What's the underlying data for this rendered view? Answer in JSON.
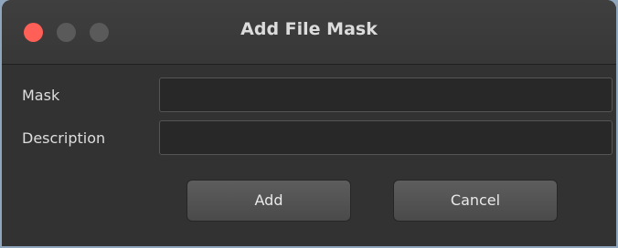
{
  "window": {
    "title": "Add File Mask",
    "traffic_lights": [
      "close-light",
      "minimize-light",
      "zoom-light"
    ]
  },
  "form": {
    "mask": {
      "label": "Mask",
      "value": "",
      "placeholder": ""
    },
    "description": {
      "label": "Description",
      "value": "",
      "placeholder": ""
    }
  },
  "buttons": {
    "add_label": "Add",
    "cancel_label": "Cancel"
  },
  "colors": {
    "close": "#fe5f57",
    "inactive_light": "#5a5a5a",
    "background": "#323232"
  }
}
